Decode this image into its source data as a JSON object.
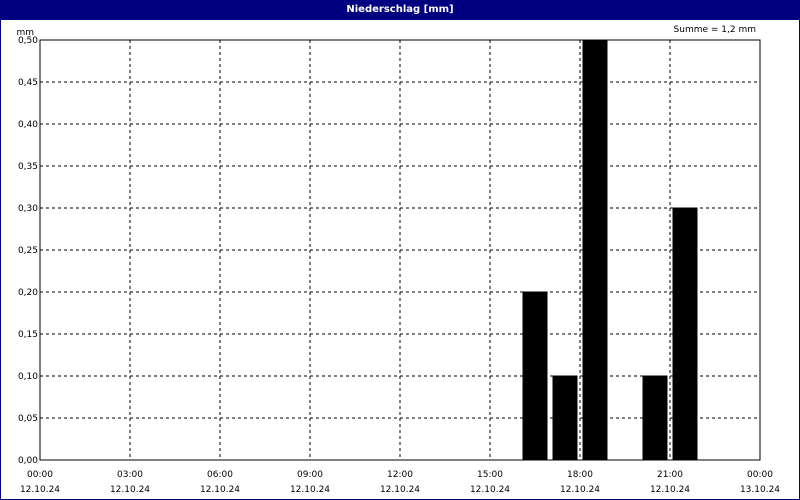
{
  "window": {
    "title": "Niederschlag [mm]"
  },
  "colors": {
    "title_bar": "#000080",
    "bars": "#000000",
    "grid": "#000000",
    "background": "#ffffff"
  },
  "chart_data": {
    "type": "bar",
    "title": "Niederschlag [mm]",
    "ylabel": "mm",
    "ylim": [
      0,
      0.5
    ],
    "y_ticks": [
      "0,00",
      "0,05",
      "0,10",
      "0,15",
      "0,20",
      "0,25",
      "0,30",
      "0,35",
      "0,40",
      "0,45",
      "0,50"
    ],
    "x_range": [
      "2024-10-12 00:00",
      "2024-10-13 00:00"
    ],
    "x_ticks": [
      {
        "time": "00:00",
        "date": "12.10.24"
      },
      {
        "time": "03:00",
        "date": "12.10.24"
      },
      {
        "time": "06:00",
        "date": "12.10.24"
      },
      {
        "time": "09:00",
        "date": "12.10.24"
      },
      {
        "time": "12:00",
        "date": "12.10.24"
      },
      {
        "time": "15:00",
        "date": "12.10.24"
      },
      {
        "time": "18:00",
        "date": "12.10.24"
      },
      {
        "time": "21:00",
        "date": "12.10.24"
      },
      {
        "time": "00:00",
        "date": "13.10.24"
      }
    ],
    "interval_hours": 1,
    "bars": [
      {
        "start": "16:00",
        "value": 0.2
      },
      {
        "start": "17:00",
        "value": 0.1
      },
      {
        "start": "18:00",
        "value": 0.5
      },
      {
        "start": "20:00",
        "value": 0.1
      },
      {
        "start": "21:00",
        "value": 0.3
      }
    ],
    "annotation": "Summe = 1,2 mm",
    "grid": true,
    "grid_style": "dashed"
  }
}
